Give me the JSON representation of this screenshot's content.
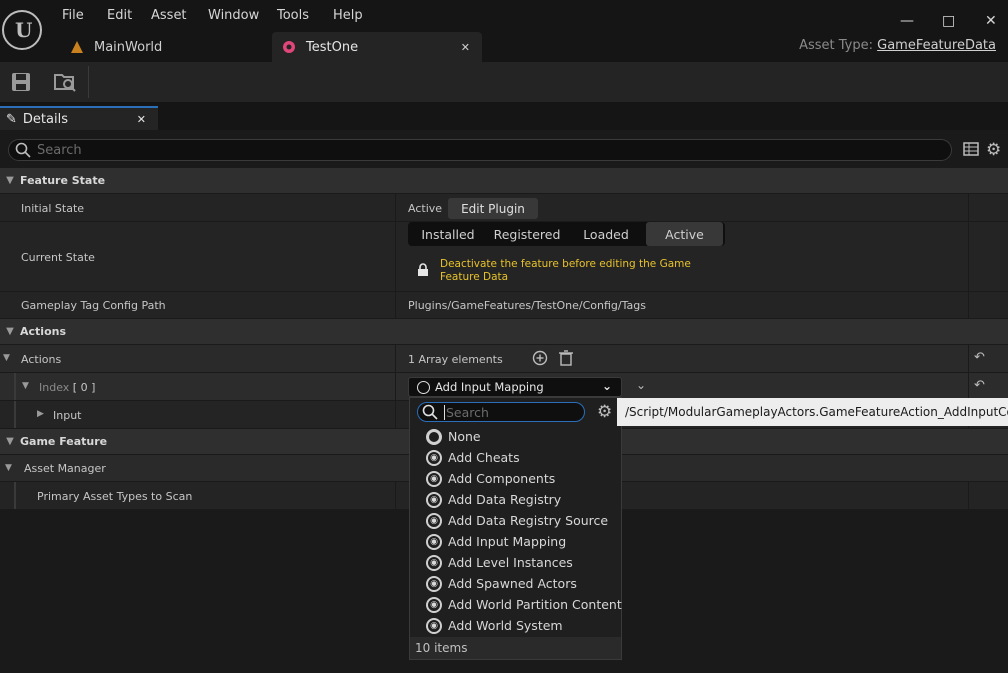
{
  "menu": [
    "File",
    "Edit",
    "Asset",
    "Window",
    "Tools",
    "Help"
  ],
  "tabs": {
    "main_world": "MainWorld",
    "test_one": "TestOne"
  },
  "asset_type": {
    "label": "Asset Type:",
    "value": "GameFeatureData"
  },
  "details": {
    "tab_label": "Details",
    "search_placeholder": "Search"
  },
  "feature_state": {
    "category": "Feature State",
    "initial_state_label": "Initial State",
    "initial_state_value": "Active",
    "edit_plugin": "Edit Plugin",
    "current_state_label": "Current State",
    "states": [
      "Installed",
      "Registered",
      "Loaded",
      "Active"
    ],
    "warning": "Deactivate the feature before editing the Game Feature Data",
    "tag_config_label": "Gameplay Tag Config Path",
    "tag_config_value": "Plugins/GameFeatures/TestOne/Config/Tags"
  },
  "actions": {
    "category": "Actions",
    "actions_label": "Actions",
    "array_count": "1 Array elements",
    "index_label": "Index",
    "index_value": "[ 0 ]",
    "input_label": "Input",
    "selected": "Add Input Mapping"
  },
  "game_feature": {
    "category": "Game Feature",
    "asset_manager": "Asset Manager",
    "primary_asset_types": "Primary Asset Types to Scan"
  },
  "popup": {
    "search_placeholder": "Search",
    "options": [
      "None",
      "Add Cheats",
      "Add Components",
      "Add Data Registry",
      "Add Data Registry Source",
      "Add Input Mapping",
      "Add Level Instances",
      "Add Spawned Actors",
      "Add World Partition Content",
      "Add World System"
    ],
    "footer": "10 items",
    "tooltip": "/Script/ModularGameplayActors.GameFeatureAction_AddInputContextMapping"
  }
}
